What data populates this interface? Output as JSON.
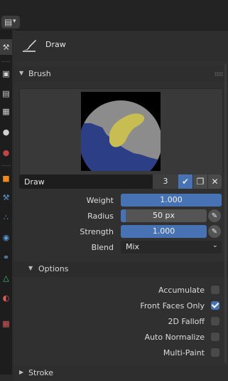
{
  "header": {
    "editor_type_icon": "properties-editor-icon",
    "tool_icon": "draw-brush-icon",
    "tool_name": "Draw"
  },
  "tabs": [
    {
      "name": "tool",
      "icon": "tool-icon",
      "color": "#d0d0d0",
      "active": true
    },
    {
      "name": "render",
      "icon": "camera-icon",
      "color": "#d0d0d0"
    },
    {
      "name": "output",
      "icon": "printer-icon",
      "color": "#d0d0d0"
    },
    {
      "name": "view-layer",
      "icon": "image-icon",
      "color": "#d0d0d0"
    },
    {
      "name": "scene",
      "icon": "scene-icon",
      "color": "#d0d0d0"
    },
    {
      "name": "world",
      "icon": "world-icon",
      "color": "#c44444"
    },
    {
      "name": "object",
      "icon": "object-icon",
      "color": "#f08a1c"
    },
    {
      "name": "modifiers",
      "icon": "wrench-icon",
      "color": "#5b9bd5"
    },
    {
      "name": "particles",
      "icon": "particles-icon",
      "color": "#5b9bd5"
    },
    {
      "name": "physics",
      "icon": "physics-icon",
      "color": "#5b9bd5"
    },
    {
      "name": "constraints",
      "icon": "constraints-icon",
      "color": "#5b9bd5"
    },
    {
      "name": "data",
      "icon": "mesh-data-icon",
      "color": "#3fc17f"
    },
    {
      "name": "material",
      "icon": "material-icon",
      "color": "#e05a5a"
    },
    {
      "name": "texture",
      "icon": "texture-icon",
      "color": "#e05a5a"
    }
  ],
  "brush_panel": {
    "title": "Brush",
    "brush_name": "Draw",
    "users": "3",
    "fake_user_icon": "shield-check-icon",
    "duplicate_icon": "duplicate-icon",
    "unlink_icon": "close-icon"
  },
  "properties": {
    "weight": {
      "label": "Weight",
      "value": "1.000",
      "fraction": 1.0
    },
    "radius": {
      "label": "Radius",
      "value": "50 px",
      "fraction": 0.06
    },
    "strength": {
      "label": "Strength",
      "value": "1.000",
      "fraction": 1.0
    },
    "blend": {
      "label": "Blend",
      "value": "Mix"
    }
  },
  "options": {
    "title": "Options",
    "items": [
      {
        "label": "Accumulate",
        "checked": false
      },
      {
        "label": "Front Faces Only",
        "checked": true
      },
      {
        "label": "2D Falloff",
        "checked": false
      },
      {
        "label": "Auto Normalize",
        "checked": false
      },
      {
        "label": "Multi-Paint",
        "checked": false
      }
    ]
  },
  "stroke": {
    "title": "Stroke"
  },
  "colors": {
    "accent": "#4772b3"
  }
}
